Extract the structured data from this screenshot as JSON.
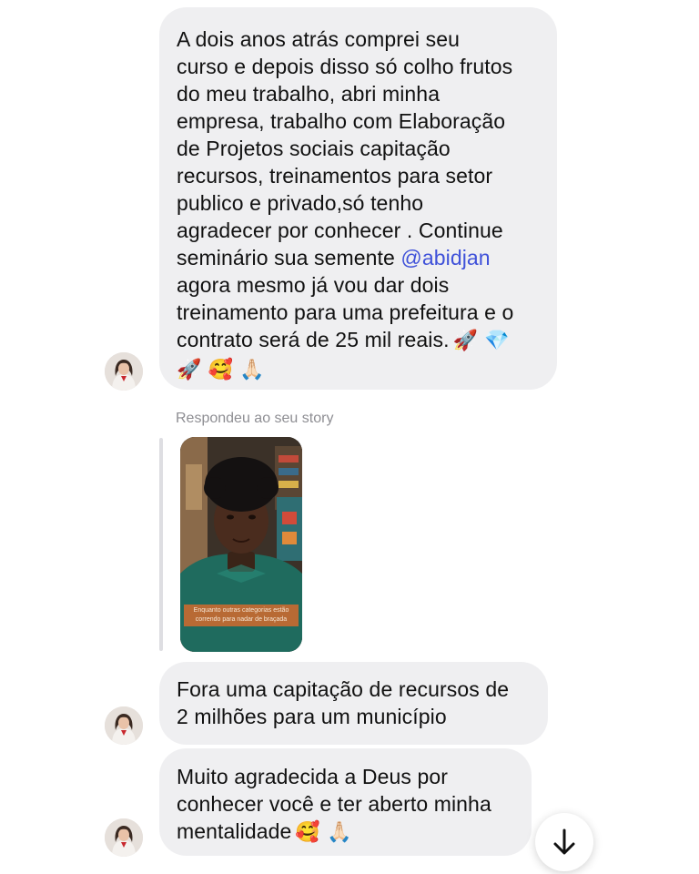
{
  "messages": [
    {
      "text_before": "A dois anos atrás comprei seu\ncurso e depois disso só colho frutos\ndo meu trabalho, abri minha\nempresa, trabalho com Elaboração\nde Projetos sociais capitação\nrecursos, treinamentos para setor\npublico e privado,só tenho\nagradecer por conhecer . Continue\nseminário sua semente ",
      "mention": "@abidjan",
      "text_after": "\nagora mesmo já vou dar dois\ntreinamento para uma prefeitura e o\ncontrato será de 25 mil reais.",
      "emoji_line1": "🚀 💎",
      "emoji_line2": "🚀 🥰 🙏🏻"
    },
    {
      "text": "Fora uma capitação de recursos de\n2 milhões para um município"
    },
    {
      "text": "Muito agradecida a Deus por\nconhecer você e ter aberto minha\nmentalidade",
      "emoji": "🥰 🙏🏻"
    }
  ],
  "story_reply": {
    "label": "Respondeu ao seu story",
    "caption": "Enquanto outras categorias estão\ncorrendo para nadar de braçada"
  },
  "icons": {
    "avatar": "user-avatar",
    "scroll": "arrow-down-icon"
  },
  "colors": {
    "bubble": "#efeff1",
    "mention": "#3f51d9",
    "caption_bg": "#b86a34"
  }
}
